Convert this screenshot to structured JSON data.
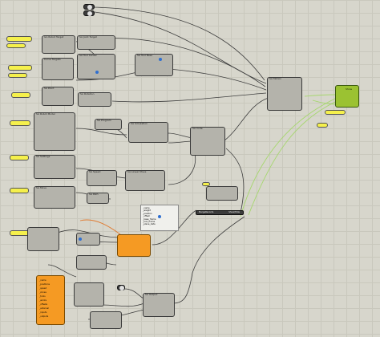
{
  "canvas": {
    "background": "#d7d6cc",
    "grid_color": "#c9c8bd"
  },
  "colors": {
    "panel_yellow": "#f5f04c",
    "geometry_green": "#9bc232",
    "cluster_orange": "#f59a23",
    "wire": "#3e3e3e",
    "wire_green": "#a6d76e",
    "orange_wire": "#e07a30"
  },
  "components": {
    "c1": {
      "title": "GA Robot Target"
    },
    "c2": {
      "title": "SA Joint Target"
    },
    "c3": {
      "title": "Curve Targets"
    },
    "c4": {
      "title": "SA Tool Center"
    },
    "c5": {
      "title": "SA Tool Base"
    },
    "c6": {
      "title": "SA Point"
    },
    "c7": {
      "title": "SA Rotation"
    },
    "c8": {
      "title": "SA Robot Model"
    },
    "c9": {
      "title": "SA Program"
    },
    "c10": {
      "title": "SA Simulation"
    },
    "c11": {
      "title": "SA Code"
    },
    "c12": {
      "title": "SA Settings"
    },
    "c13": {
      "title": "SA Speed"
    },
    "c14": {
      "title": "SA Linear Move"
    },
    "c15": {
      "title": "SA Move"
    },
    "c16": {
      "title": "SA Path"
    },
    "c17": {
      "title": "SA Motion"
    },
    "c18": {
      "title": "SA Output"
    }
  },
  "note": {
    "lines": [
      "_name",
      "_weight",
      "_position",
      "_offset",
      "_base_frame",
      "_tool_frame",
      "_plane_data"
    ]
  },
  "merge_node": {
    "label": "MergeRecords",
    "output": "Show/Hide"
  },
  "geometry": {
    "title": "Show"
  },
  "cluster": {
    "lines": [
      "_name",
      "_positions",
      "_speed",
      "_zones",
      "_tools",
      "_works",
      "_offsets",
      "_external",
      "_inputs",
      "_outputs"
    ]
  }
}
